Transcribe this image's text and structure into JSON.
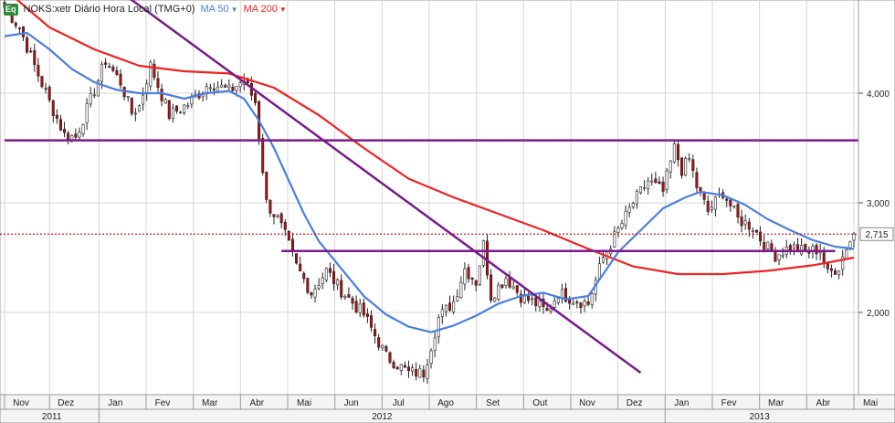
{
  "header": {
    "badge": "Eq",
    "symbol_label": "NOKS:xetr Diário Hora Local (TMG+0)",
    "ma50_label": "MA 50",
    "ma200_label": "MA 200",
    "caret": "▼"
  },
  "colors": {
    "ma50": "#4a7fe0",
    "ma200": "#ee2222",
    "trendline": "#7a1a8c",
    "price_marker": "#cc0000",
    "candle_up": "#ffffff",
    "candle_down": "#b01010",
    "grid": "#d6d6d6",
    "axis_bg": "#f4f4f4",
    "badge": "#2e8b3a"
  },
  "chart_data": {
    "type": "candlestick",
    "ylim": [
      1.25,
      4.85
    ],
    "y_ticks": [
      "2,000",
      "3,000",
      "4,000"
    ],
    "y_tick_values": [
      2.0,
      3.0,
      4.0
    ],
    "last_price_label": "2,715",
    "last_price": 2.715,
    "months": [
      "Nov",
      "Dez",
      "Jan",
      "Fev",
      "Mar",
      "Abr",
      "Mai",
      "Jun",
      "Jul",
      "Ago",
      "Set",
      "Out",
      "Nov",
      "Dez",
      "Jan",
      "Fev",
      "Mar",
      "Abr",
      "Mai"
    ],
    "years": [
      "2011",
      "2012",
      "2013"
    ],
    "close_path": [
      [
        0,
        4.78
      ],
      [
        4,
        4.6
      ],
      [
        8,
        4.25
      ],
      [
        12,
        3.92
      ],
      [
        16,
        3.62
      ],
      [
        19,
        3.6
      ],
      [
        22,
        3.85
      ],
      [
        27,
        4.3
      ],
      [
        31,
        4.1
      ],
      [
        34,
        3.82
      ],
      [
        36,
        3.88
      ],
      [
        39,
        4.25
      ],
      [
        44,
        3.8
      ],
      [
        49,
        3.9
      ],
      [
        55,
        4.1
      ],
      [
        60,
        4.02
      ],
      [
        64,
        4.12
      ],
      [
        67,
        3.92
      ],
      [
        70,
        3.0
      ],
      [
        73,
        2.85
      ],
      [
        75,
        2.7
      ],
      [
        78,
        2.42
      ],
      [
        82,
        2.18
      ],
      [
        86,
        2.38
      ],
      [
        90,
        2.2
      ],
      [
        96,
        1.98
      ],
      [
        102,
        1.6
      ],
      [
        108,
        1.45
      ],
      [
        112,
        1.45
      ],
      [
        116,
        1.95
      ],
      [
        120,
        2.1
      ],
      [
        123,
        2.4
      ],
      [
        126,
        2.28
      ],
      [
        128,
        2.62
      ],
      [
        130,
        2.15
      ],
      [
        134,
        2.32
      ],
      [
        138,
        2.15
      ],
      [
        142,
        2.08
      ],
      [
        145,
        2.0
      ],
      [
        148,
        2.18
      ],
      [
        152,
        2.12
      ],
      [
        156,
        2.08
      ],
      [
        160,
        2.5
      ],
      [
        164,
        2.75
      ],
      [
        168,
        3.0
      ],
      [
        172,
        3.2
      ],
      [
        176,
        3.1
      ],
      [
        179,
        3.5
      ],
      [
        181,
        3.3
      ],
      [
        183,
        3.4
      ],
      [
        185,
        3.15
      ],
      [
        188,
        2.92
      ],
      [
        192,
        3.1
      ],
      [
        196,
        2.85
      ],
      [
        200,
        2.78
      ],
      [
        203,
        2.62
      ],
      [
        206,
        2.52
      ],
      [
        210,
        2.6
      ],
      [
        214,
        2.55
      ],
      [
        218,
        2.58
      ],
      [
        220,
        2.35
      ],
      [
        223,
        2.42
      ],
      [
        225,
        2.6
      ],
      [
        227,
        2.715
      ]
    ],
    "ma50": [
      [
        0,
        4.52
      ],
      [
        6,
        4.55
      ],
      [
        12,
        4.4
      ],
      [
        18,
        4.22
      ],
      [
        24,
        4.1
      ],
      [
        30,
        4.03
      ],
      [
        36,
        4.0
      ],
      [
        42,
        4.0
      ],
      [
        48,
        3.95
      ],
      [
        54,
        4.0
      ],
      [
        60,
        4.02
      ],
      [
        64,
        3.95
      ],
      [
        68,
        3.75
      ],
      [
        72,
        3.5
      ],
      [
        76,
        3.2
      ],
      [
        80,
        2.9
      ],
      [
        84,
        2.65
      ],
      [
        90,
        2.4
      ],
      [
        96,
        2.15
      ],
      [
        102,
        1.98
      ],
      [
        108,
        1.87
      ],
      [
        114,
        1.82
      ],
      [
        120,
        1.88
      ],
      [
        126,
        1.97
      ],
      [
        132,
        2.08
      ],
      [
        138,
        2.15
      ],
      [
        144,
        2.18
      ],
      [
        150,
        2.12
      ],
      [
        156,
        2.15
      ],
      [
        160,
        2.35
      ],
      [
        164,
        2.55
      ],
      [
        170,
        2.75
      ],
      [
        176,
        2.95
      ],
      [
        182,
        3.05
      ],
      [
        186,
        3.1
      ],
      [
        192,
        3.07
      ],
      [
        198,
        2.98
      ],
      [
        204,
        2.85
      ],
      [
        210,
        2.75
      ],
      [
        216,
        2.66
      ],
      [
        222,
        2.6
      ],
      [
        227,
        2.58
      ]
    ],
    "ma200": [
      [
        0,
        4.95
      ],
      [
        12,
        4.6
      ],
      [
        24,
        4.4
      ],
      [
        36,
        4.25
      ],
      [
        48,
        4.2
      ],
      [
        60,
        4.18
      ],
      [
        72,
        4.05
      ],
      [
        84,
        3.8
      ],
      [
        96,
        3.5
      ],
      [
        108,
        3.22
      ],
      [
        120,
        3.05
      ],
      [
        132,
        2.9
      ],
      [
        144,
        2.75
      ],
      [
        156,
        2.58
      ],
      [
        168,
        2.42
      ],
      [
        180,
        2.35
      ],
      [
        192,
        2.35
      ],
      [
        204,
        2.38
      ],
      [
        216,
        2.43
      ],
      [
        227,
        2.5
      ]
    ],
    "trendlines": [
      {
        "x1": 30,
        "y1": 4.95,
        "x2": 170,
        "y2": 1.45
      },
      {
        "x1": 0,
        "y1": 3.57,
        "x2": 236,
        "y2": 3.57
      },
      {
        "x1": 74,
        "y1": 2.56,
        "x2": 222,
        "y2": 2.56
      }
    ]
  }
}
